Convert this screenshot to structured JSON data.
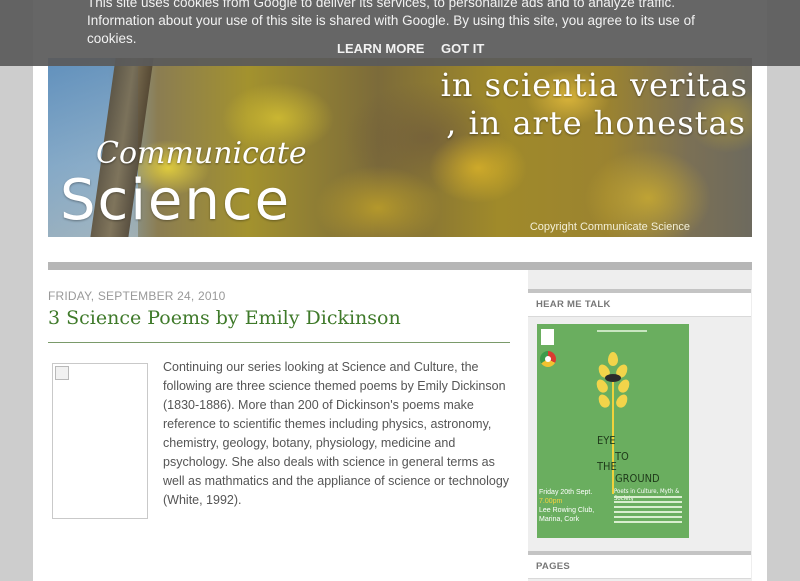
{
  "cookie_bar": {
    "message": "This site uses cookies from Google to deliver its services, to personalize ads and to analyze traffic. Information about your use of this site is shared with Google. By using this site, you agree to its use of cookies.",
    "learn_more": "LEARN MORE",
    "got_it": "GOT IT"
  },
  "header": {
    "tagline_1": "in scientia veritas",
    "tagline_2": ", in arte honestas",
    "brand_small": "Communicate",
    "brand_big": "Science",
    "copyright": "Copyright Communicate Science"
  },
  "post": {
    "date": "FRIDAY, SEPTEMBER 24, 2010",
    "title": "3 Science Poems by Emily Dickinson",
    "body": "Continuing our series looking at Science and Culture, the following are three science themed poems by Emily Dickinson (1830-1886). More than 200 of Dickinson's poems make reference to scientific themes including physics, astronomy, chemistry, geology, botany, physiology, medicine and psychology. She also deals with science in general terms as well as mathmatics and the appliance of science or technology (White, 1992)."
  },
  "sidebar": {
    "widget_1_title": "HEAR ME TALK",
    "widget_2_title": "PAGES",
    "poster": {
      "title_line1": "EYE",
      "title_line2": "TO",
      "title_line3": "THE",
      "title_line4": "GROUND",
      "subtitle": "Poets in Culture, Myth & Society",
      "event_date": "Friday 20th Sept.",
      "event_time": "7.00pm",
      "event_venue_1": "Lee Rowing Club,",
      "event_venue_2": "Marina, Cork"
    }
  }
}
